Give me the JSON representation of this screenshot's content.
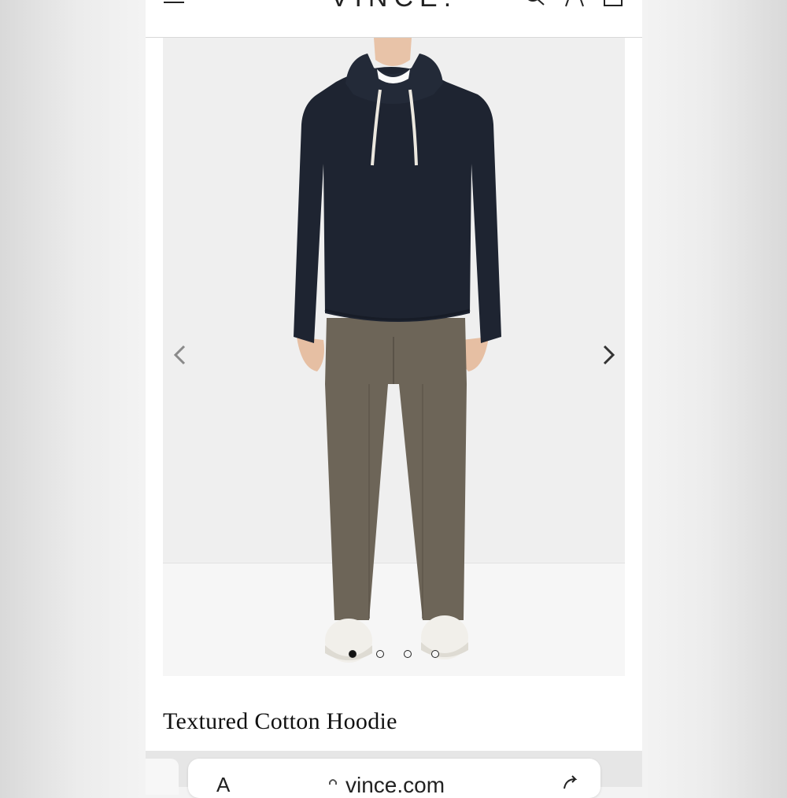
{
  "header": {
    "brand": "VINCE.",
    "menu_icon": "hamburger-menu-icon",
    "search_icon": "search-icon",
    "account_icon": "account-icon",
    "bag_icon": "shopping-bag-icon"
  },
  "gallery": {
    "prev_icon": "chevron-left-icon",
    "next_icon": "chevron-right-icon",
    "image_count": 4,
    "active_index": 0
  },
  "product": {
    "title": "Textured Cotton Hoodie"
  },
  "browser": {
    "url": "vince.com",
    "aa_label": "A",
    "lock_icon": "lock-icon",
    "reload_icon": "reload-icon"
  },
  "colors": {
    "hoodie": "#1e2431",
    "pants": "#6d6558",
    "background": "#efefef"
  }
}
